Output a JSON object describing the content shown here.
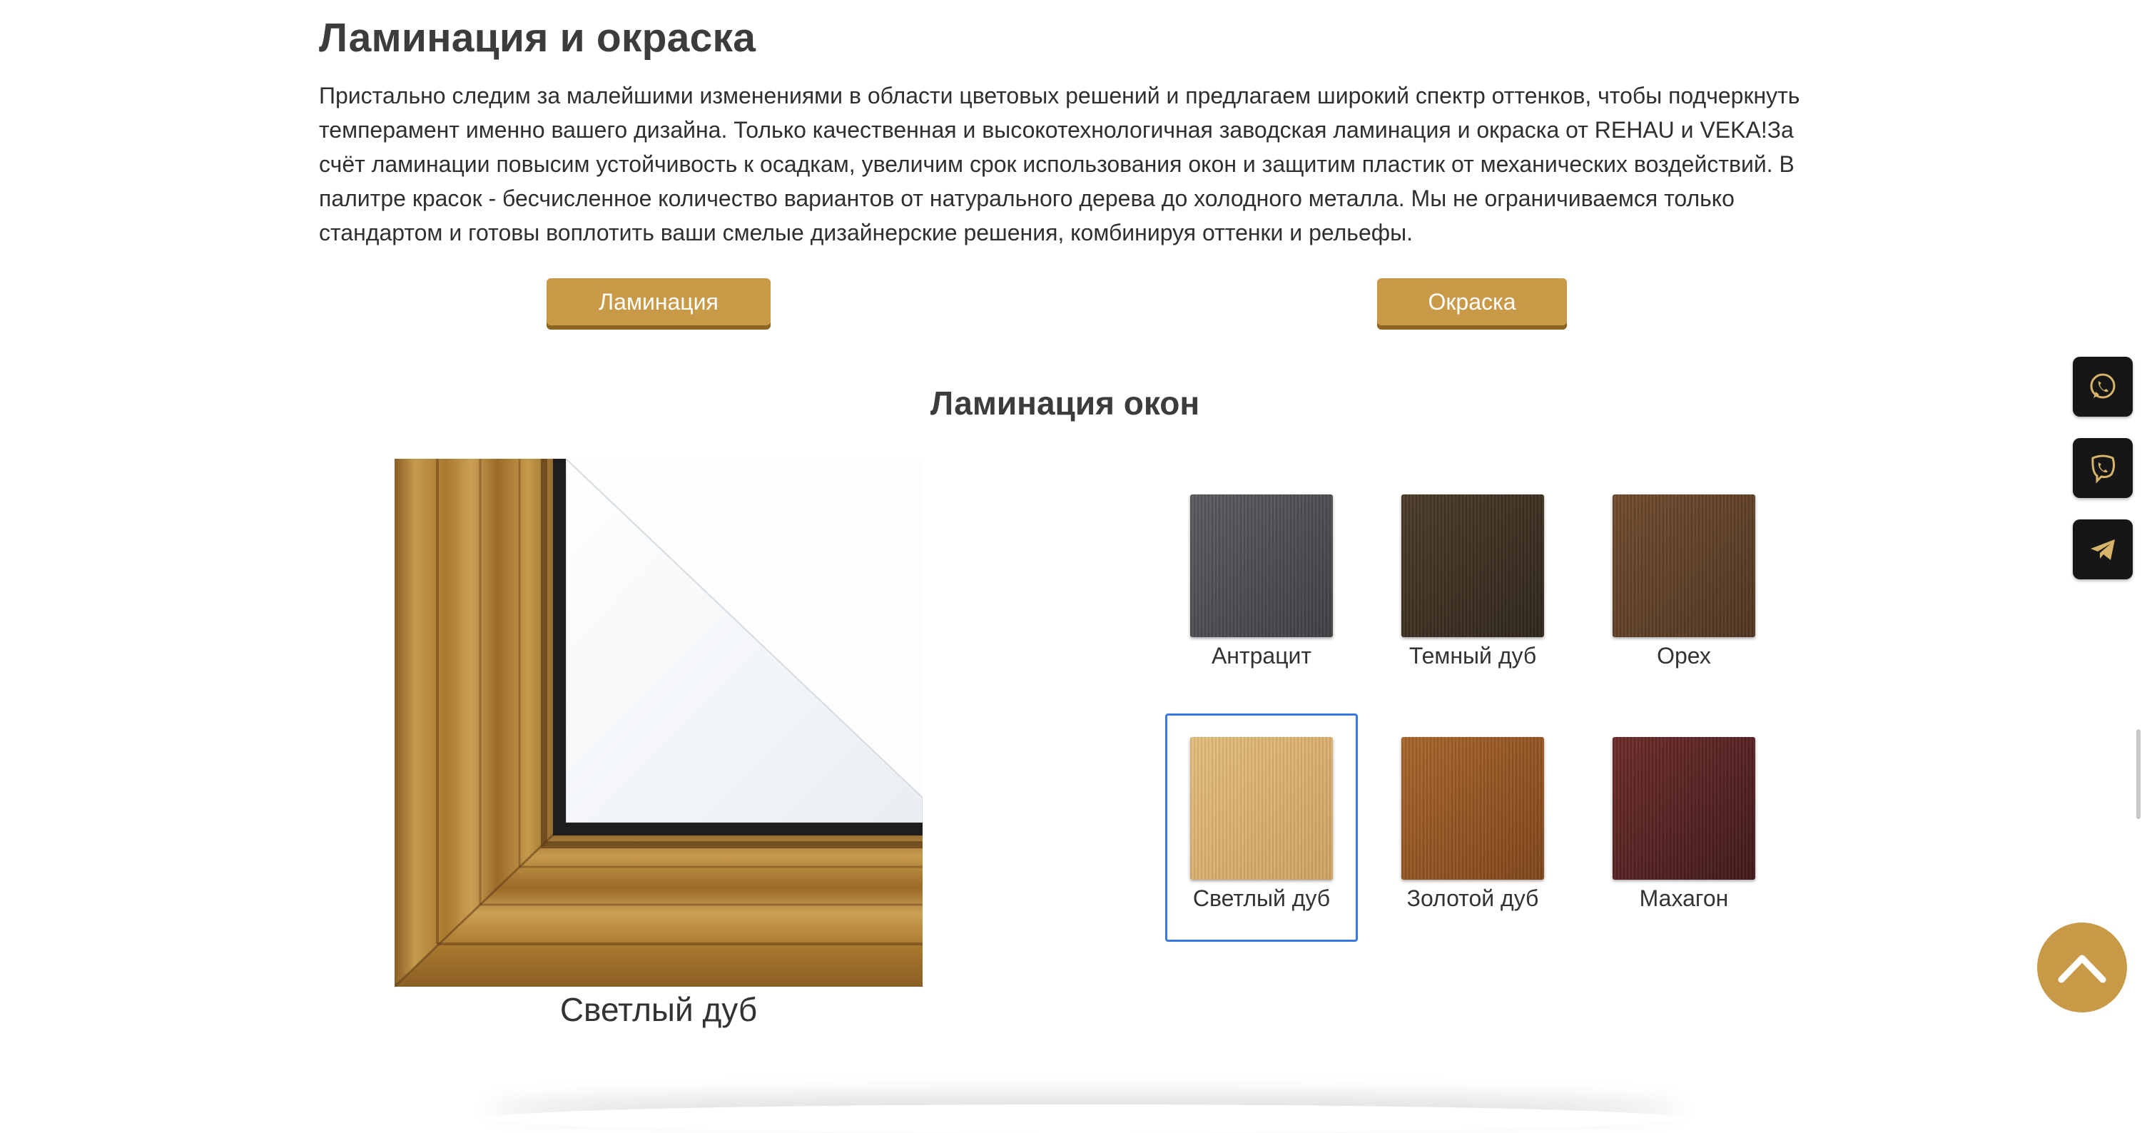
{
  "section": {
    "title": "Ламинация и окраска",
    "intro": "Пристально следим за малейшими изменениями в области цветовых решений и предлагаем широкий спектр оттенков, чтобы подчеркнуть темперамент именно вашего дизайна. Только качественная и высокотехнологичная заводская ламинация и окраска от REHAU и VEKA!За счёт ламинации повысим устойчивость к осадкам, увеличим срок использования окон и защитим пластик от механических воздействий. В палитре красок - бесчисленное количество вариантов от натурального дерева до холодного металла. Мы не ограничиваемся только стандартом и готовы воплотить ваши смелые дизайнерские решения, комбинируя оттенки и рельефы."
  },
  "tabs": {
    "lamination": "Ламинация",
    "paint": "Окраска"
  },
  "gallery": {
    "title": "Ламинация окон",
    "preview_caption": "Светлый дуб",
    "selected": "Светлый дуб",
    "swatches": [
      {
        "name": "Антрацит",
        "color_light": "#585a5e",
        "color_dark": "#3d3f43"
      },
      {
        "name": "Темный дуб",
        "color_light": "#4a3a28",
        "color_dark": "#2e2419"
      },
      {
        "name": "Орех",
        "color_light": "#6e4a2c",
        "color_dark": "#4f3420"
      },
      {
        "name": "Светлый дуб",
        "color_light": "#e3bd7c",
        "color_dark": "#cfa161"
      },
      {
        "name": "Золотой дуб",
        "color_light": "#a7642a",
        "color_dark": "#7f4519"
      },
      {
        "name": "Махагон",
        "color_light": "#6b2a2a",
        "color_dark": "#401818"
      }
    ]
  },
  "floating": {
    "whatsapp_icon": "whatsapp-icon",
    "viber_icon": "viber-icon",
    "telegram_icon": "telegram-icon",
    "scroll_top_icon": "chevron-up-icon"
  },
  "colors": {
    "accent": "#c89a48",
    "accent_dark": "#8c6521",
    "selected_border": "#3a7be0",
    "icon_gold": "#d8b46a"
  }
}
